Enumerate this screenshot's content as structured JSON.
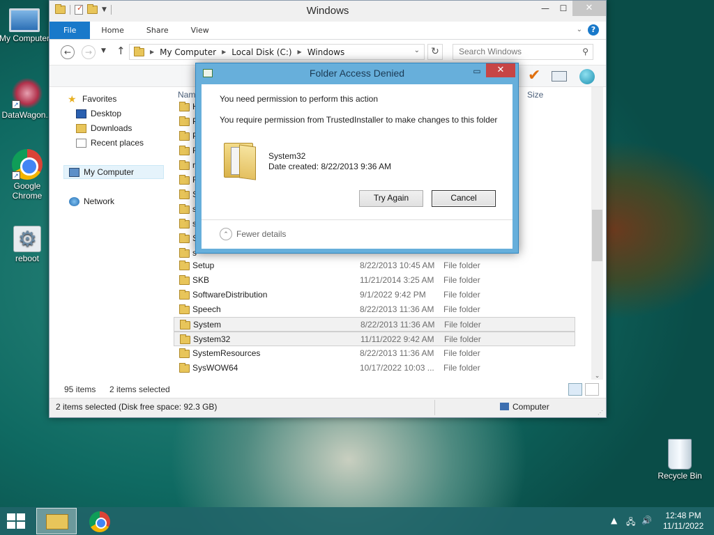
{
  "desktop": {
    "icons": [
      {
        "label": "My Computer"
      },
      {
        "label": "DataWagon..."
      },
      {
        "label": "Google Chrome"
      },
      {
        "label": "reboot"
      },
      {
        "label": "Recycle Bin"
      }
    ]
  },
  "explorer": {
    "title": "Windows",
    "ribbon_tabs": [
      "File",
      "Home",
      "Share",
      "View"
    ],
    "address": {
      "crumbs": [
        "My Computer",
        "Local Disk (C:)",
        "Windows"
      ]
    },
    "search_placeholder": "Search Windows",
    "nav": {
      "favorites": "Favorites",
      "desktop": "Desktop",
      "downloads": "Downloads",
      "recent": "Recent places",
      "computer": "My Computer",
      "network": "Network"
    },
    "columns": {
      "name": "Name",
      "size": "Size"
    },
    "partial_names": [
      "H",
      "P",
      "P",
      "R",
      "r",
      "R",
      "S",
      "s",
      "s",
      "S",
      "s"
    ],
    "files": [
      {
        "name": "Setup",
        "date": "8/22/2013 10:45 AM",
        "type": "File folder",
        "selected": false
      },
      {
        "name": "SKB",
        "date": "11/21/2014 3:25 AM",
        "type": "File folder",
        "selected": false
      },
      {
        "name": "SoftwareDistribution",
        "date": "9/1/2022 9:42 PM",
        "type": "File folder",
        "selected": false
      },
      {
        "name": "Speech",
        "date": "8/22/2013 11:36 AM",
        "type": "File folder",
        "selected": false
      },
      {
        "name": "System",
        "date": "8/22/2013 11:36 AM",
        "type": "File folder",
        "selected": true
      },
      {
        "name": "System32",
        "date": "11/11/2022 9:42 AM",
        "type": "File folder",
        "selected": true
      },
      {
        "name": "SystemResources",
        "date": "8/22/2013 11:36 AM",
        "type": "File folder",
        "selected": false
      },
      {
        "name": "SysWOW64",
        "date": "10/17/2022 10:03 ...",
        "type": "File folder",
        "selected": false
      }
    ],
    "status": {
      "count": "95 items",
      "selected": "2 items selected"
    },
    "details_bar": {
      "info": "2 items selected (Disk free space: 92.3 GB)",
      "zone": "Computer"
    }
  },
  "dialog": {
    "title": "Folder Access Denied",
    "message": "You need permission to perform this action",
    "detail": "You require permission from TrustedInstaller to make changes to this folder",
    "item_name": "System32",
    "item_date": "Date created: 8/22/2013 9:36 AM",
    "try_again": "Try Again",
    "cancel": "Cancel",
    "fewer_details": "Fewer details"
  },
  "taskbar": {
    "time": "12:48 PM",
    "date": "11/11/2022"
  }
}
